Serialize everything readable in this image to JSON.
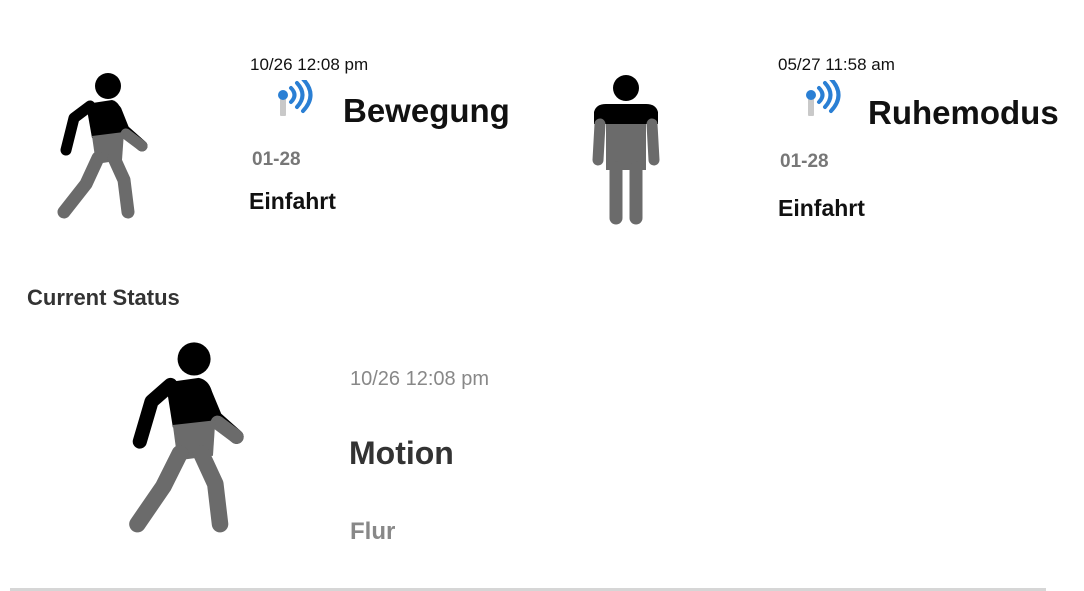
{
  "events": [
    {
      "timestamp": "10/26 12:08 pm",
      "event": "Bewegung",
      "zone_code": "01-28",
      "location": "Einfahrt",
      "figure_icon": "walking-person-icon",
      "signal_icon": "wireless-signal-icon"
    },
    {
      "timestamp": "05/27 11:58 am",
      "event": "Ruhemodus",
      "zone_code": "01-28",
      "location": "Einfahrt",
      "figure_icon": "standing-person-icon",
      "signal_icon": "wireless-signal-icon"
    }
  ],
  "current_status": {
    "title": "Current Status",
    "timestamp": "10/26 12:08 pm",
    "event": "Motion",
    "location": "Flur",
    "figure_icon": "walking-person-icon"
  },
  "colors": {
    "figure_dark": "#000000",
    "figure_gray": "#6b6b6b",
    "signal_blue": "#2a7fd4",
    "divider": "#d6d6d6"
  }
}
